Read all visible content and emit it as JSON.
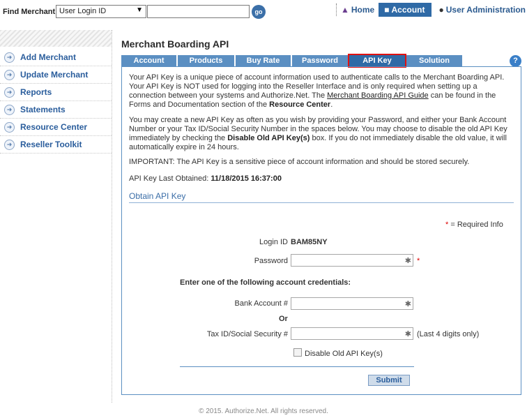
{
  "find": {
    "label": "Find Merchant:",
    "select_value": "User Login ID",
    "go_label": "go"
  },
  "topnav": {
    "home": "Home",
    "account": "Account",
    "admin": "User Administration"
  },
  "sidebar": {
    "items": [
      {
        "label": "Add Merchant"
      },
      {
        "label": "Update Merchant"
      },
      {
        "label": "Reports"
      },
      {
        "label": "Statements"
      },
      {
        "label": "Resource Center"
      },
      {
        "label": "Reseller Toolkit"
      }
    ]
  },
  "main": {
    "title": "Merchant Boarding API",
    "tabs": [
      {
        "label": "Account"
      },
      {
        "label": "Products"
      },
      {
        "label": "Buy Rate"
      },
      {
        "label": "Password"
      },
      {
        "label": "API Key"
      },
      {
        "label": "Solution"
      }
    ],
    "help": "?",
    "para1_a": "Your API Key is a unique piece of account information used to authenticate calls to the Merchant Boarding API. Your API Key is NOT used for logging into the Reseller Interface and is only required when setting up a connection between your systems and Authorize.Net. The ",
    "para1_link": "Merchant Boarding API Guide",
    "para1_b": " can be found in the Forms and Documentation section of the ",
    "para1_bold": "Resource Center",
    "para1_c": ".",
    "para2_a": "You may create a new API Key as often as you wish by providing your Password, and either your Bank Account Number or your Tax ID/Social Security Number in the spaces below. You may choose to disable the old API Key immediately by checking the ",
    "para2_bold": "Disable Old API Key(s)",
    "para2_b": " box. If you do not immediately disable the old value, it will automatically expire in 24 hours.",
    "important": "IMPORTANT: The API Key is a sensitive piece of account information and should be stored securely.",
    "last_obtained_label": "API Key Last Obtained: ",
    "last_obtained_value": "11/18/2015 16:37:00",
    "obtain_title": "Obtain API Key"
  },
  "form": {
    "required_star": "*",
    "required_note": " = Required Info",
    "login_label": "Login ID",
    "login_value": "BAM85NY",
    "password_label": "Password",
    "section_note": "Enter one of the following account credentials:",
    "bank_label": "Bank Account #",
    "or_label": "Or",
    "tax_label": "Tax ID/Social Security #",
    "last4": "(Last 4 digits only)",
    "disable_label": "Disable Old API Key(s)",
    "submit": "Submit"
  },
  "footer": "© 2015. Authorize.Net. All rights reserved."
}
